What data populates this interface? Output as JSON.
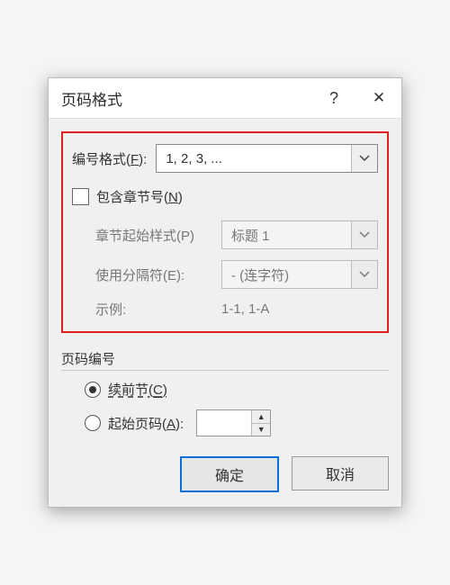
{
  "title": "页码格式",
  "help_symbol": "?",
  "close_symbol": "✕",
  "format": {
    "label_prefix": "编号格式(",
    "label_key": "F",
    "label_suffix": "):",
    "value": "1, 2, 3, ..."
  },
  "include_chapter": {
    "checked": false,
    "label_prefix": "包含章节号(",
    "label_key": "N",
    "label_suffix": ")"
  },
  "chapter_style": {
    "label": "章节起始样式(P)",
    "value": "标题 1"
  },
  "separator": {
    "label": "使用分隔符(E):",
    "value": "-  (连字符)"
  },
  "example": {
    "label": "示例:",
    "value": "1-1, 1-A"
  },
  "numbering_header": "页码编号",
  "continue_option": {
    "selected": true,
    "label_prefix": "续前节(",
    "label_key": "C",
    "label_suffix": ")"
  },
  "start_at_option": {
    "selected": false,
    "label_prefix": "起始页码(",
    "label_key": "A",
    "label_suffix": "):",
    "value": ""
  },
  "ok_label": "确定",
  "cancel_label": "取消"
}
